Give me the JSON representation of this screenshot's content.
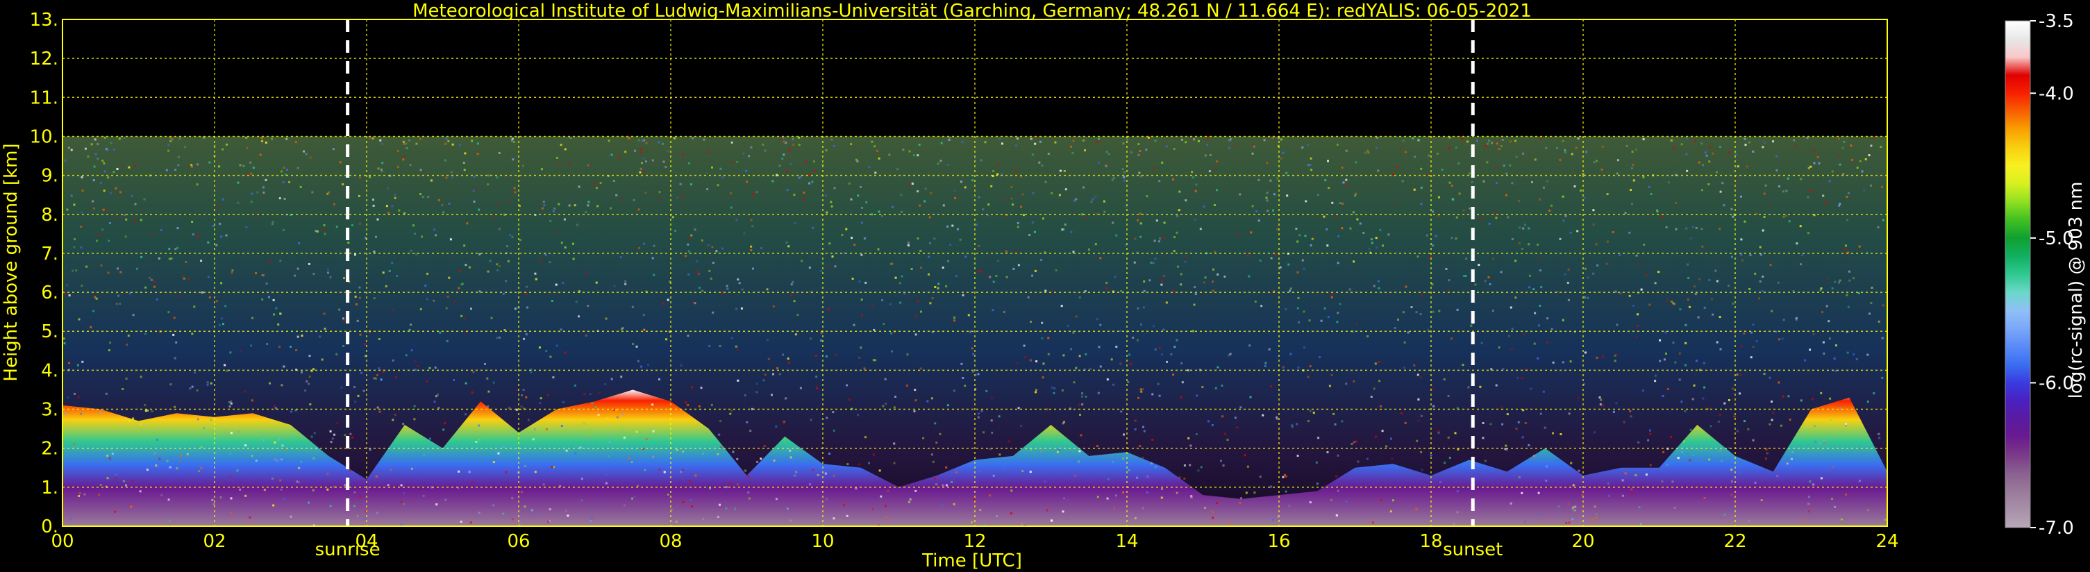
{
  "chart_data": {
    "type": "heatmap",
    "title": "Meteorological Institute of Ludwig-Maximilians-Universität (Garching, Germany; 48.261 N / 11.664 E):    redYALIS: 06-05-2021",
    "xlabel": "Time [UTC]",
    "ylabel": "Height above ground [km]",
    "xlim": [
      0,
      24
    ],
    "ylim": [
      0,
      13
    ],
    "x_ticks": [
      "00",
      "02",
      "04",
      "06",
      "08",
      "10",
      "12",
      "14",
      "16",
      "18",
      "20",
      "22",
      "24"
    ],
    "y_ticks": [
      "0.",
      "1.",
      "2.",
      "3.",
      "4.",
      "5.",
      "6.",
      "7.",
      "8.",
      "9.",
      "10.",
      "11.",
      "12.",
      "13."
    ],
    "grid": true,
    "data_top_km": 10,
    "events": [
      {
        "label": "sunrise",
        "time": 3.75
      },
      {
        "label": "sunset",
        "time": 18.55
      }
    ],
    "colorbar": {
      "label": "log(rc-signal) @ 903 nm",
      "range": [
        -7.0,
        -3.5
      ],
      "ticks": [
        "-3.5",
        "-4.0",
        "-5.0",
        "-6.0",
        "-7.0"
      ],
      "tick_values": [
        -3.5,
        -4.0,
        -5.0,
        -6.0,
        -7.0
      ],
      "colors": [
        "#b8a8b8",
        "#a890a8",
        "#9a7a9a",
        "#8a6090",
        "#7a3a88",
        "#6a1a90",
        "#5a1aa0",
        "#4a20c0",
        "#3a3ae0",
        "#3a6ef0",
        "#5a8af8",
        "#7aa8f8",
        "#90c0f8",
        "#6ad8c8",
        "#30c890",
        "#10b060",
        "#10a030",
        "#40c020",
        "#90e020",
        "#d8f020",
        "#f8f020",
        "#f8d010",
        "#f8a000",
        "#f86000",
        "#f82000",
        "#e00000",
        "#f8c8c8",
        "#e8e8e8",
        "#ffffff"
      ]
    },
    "cloud_layer_top_km": [
      [
        0,
        3.1
      ],
      [
        0.5,
        3.0
      ],
      [
        1,
        2.7
      ],
      [
        1.5,
        2.9
      ],
      [
        2,
        2.8
      ],
      [
        2.5,
        2.9
      ],
      [
        3,
        2.6
      ],
      [
        3.5,
        1.8
      ],
      [
        4,
        1.2
      ],
      [
        4.5,
        2.6
      ],
      [
        5,
        2.0
      ],
      [
        5.5,
        3.2
      ],
      [
        6,
        2.4
      ],
      [
        6.5,
        3.0
      ],
      [
        7,
        3.2
      ],
      [
        7.5,
        3.5
      ],
      [
        8,
        3.2
      ],
      [
        8.5,
        2.5
      ],
      [
        9,
        1.3
      ],
      [
        9.5,
        2.3
      ],
      [
        10,
        1.6
      ],
      [
        10.5,
        1.5
      ],
      [
        11,
        1.0
      ],
      [
        11.5,
        1.3
      ],
      [
        12,
        1.7
      ],
      [
        12.5,
        1.8
      ],
      [
        13,
        2.6
      ],
      [
        13.5,
        1.8
      ],
      [
        14,
        1.9
      ],
      [
        14.5,
        1.5
      ],
      [
        15,
        0.8
      ],
      [
        15.5,
        0.7
      ],
      [
        16,
        0.8
      ],
      [
        16.5,
        0.9
      ],
      [
        17,
        1.5
      ],
      [
        17.5,
        1.6
      ],
      [
        18,
        1.3
      ],
      [
        18.5,
        1.7
      ],
      [
        19,
        1.4
      ],
      [
        19.5,
        2.0
      ],
      [
        20,
        1.3
      ],
      [
        20.5,
        1.5
      ],
      [
        21,
        1.5
      ],
      [
        21.5,
        2.6
      ],
      [
        22,
        1.8
      ],
      [
        22.5,
        1.4
      ],
      [
        23,
        3.0
      ],
      [
        23.5,
        3.3
      ],
      [
        24,
        1.4
      ]
    ]
  }
}
